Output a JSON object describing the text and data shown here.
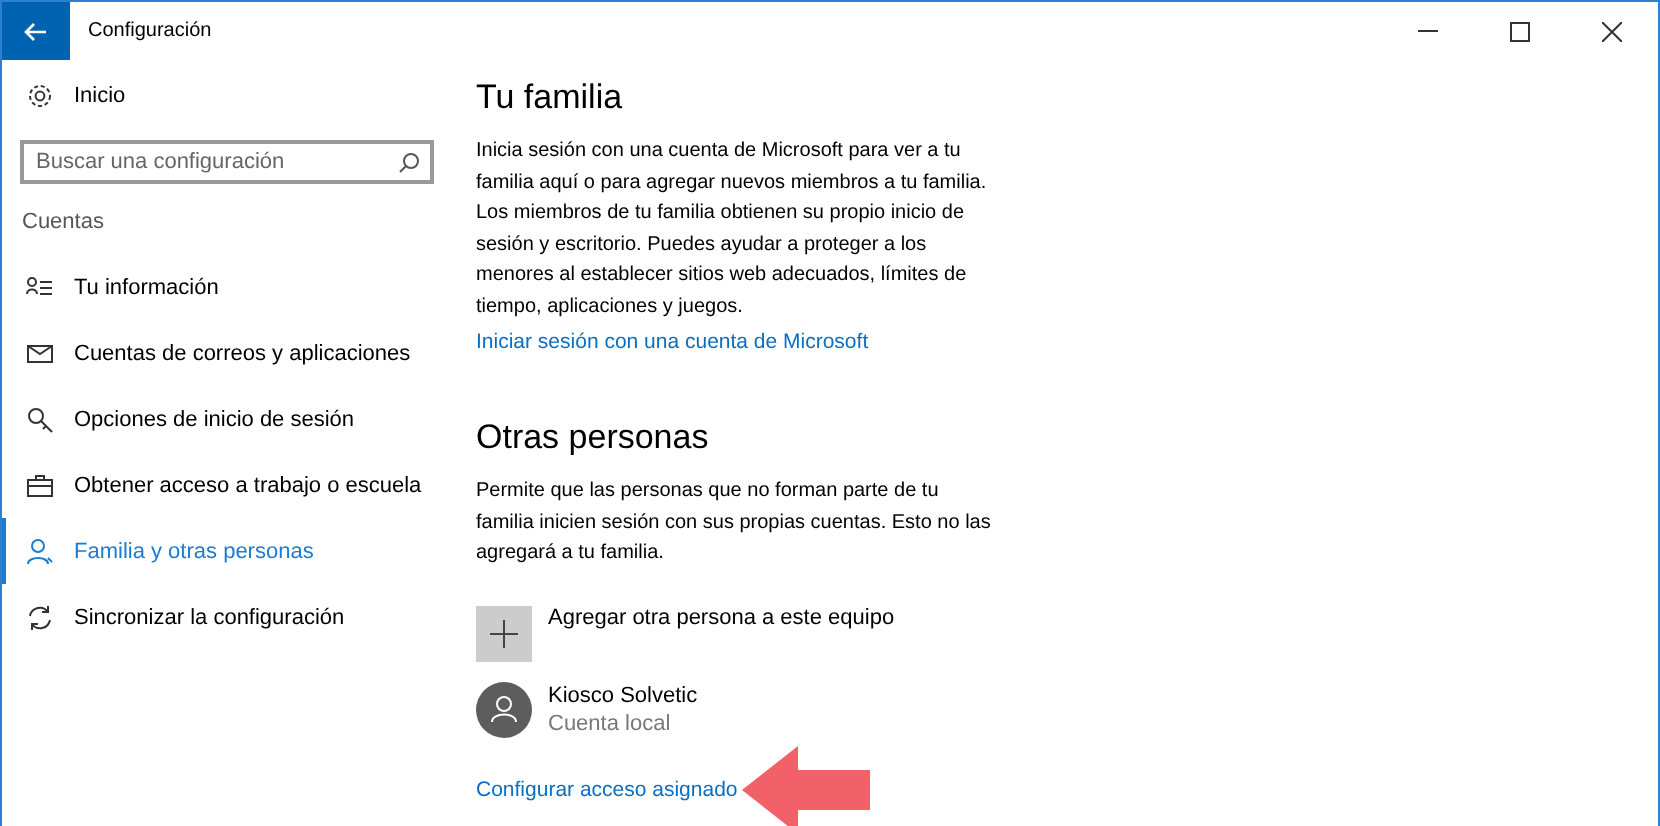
{
  "window": {
    "title": "Configuración"
  },
  "sidebar": {
    "home": "Inicio",
    "search": {
      "placeholder": "Buscar una configuración"
    },
    "section": "Cuentas",
    "items": [
      {
        "label": "Tu información",
        "kind": "info",
        "selected": false
      },
      {
        "label": "Cuentas de correos y aplicaciones",
        "kind": "mail",
        "selected": false
      },
      {
        "label": "Opciones de inicio de sesión",
        "kind": "key",
        "selected": false
      },
      {
        "label": "Obtener acceso a trabajo o escuela",
        "kind": "briefcase",
        "selected": false
      },
      {
        "label": "Familia y otras personas",
        "kind": "person",
        "selected": true
      },
      {
        "label": "Sincronizar la configuración",
        "kind": "sync",
        "selected": false
      }
    ]
  },
  "family": {
    "title": "Tu familia",
    "text": "Inicia sesión con una cuenta de Microsoft para ver a tu familia aquí o para agregar nuevos miembros a tu familia. Los miembros de tu familia obtienen su propio inicio de sesión y escritorio. Puedes ayudar a proteger a los menores al establecer sitios web adecuados, límites de tiempo, aplicaciones y juegos.",
    "link": "Iniciar sesión con una cuenta de Microsoft"
  },
  "others": {
    "title": "Otras personas",
    "text": "Permite que las personas que no forman parte de tu familia inicien sesión con sus propias cuentas. Esto no las agregará a tu familia.",
    "add": "Agregar otra persona a este equipo",
    "accounts": [
      {
        "name": "Kiosco Solvetic",
        "type": "Cuenta local"
      }
    ],
    "link": "Configurar acceso asignado"
  }
}
